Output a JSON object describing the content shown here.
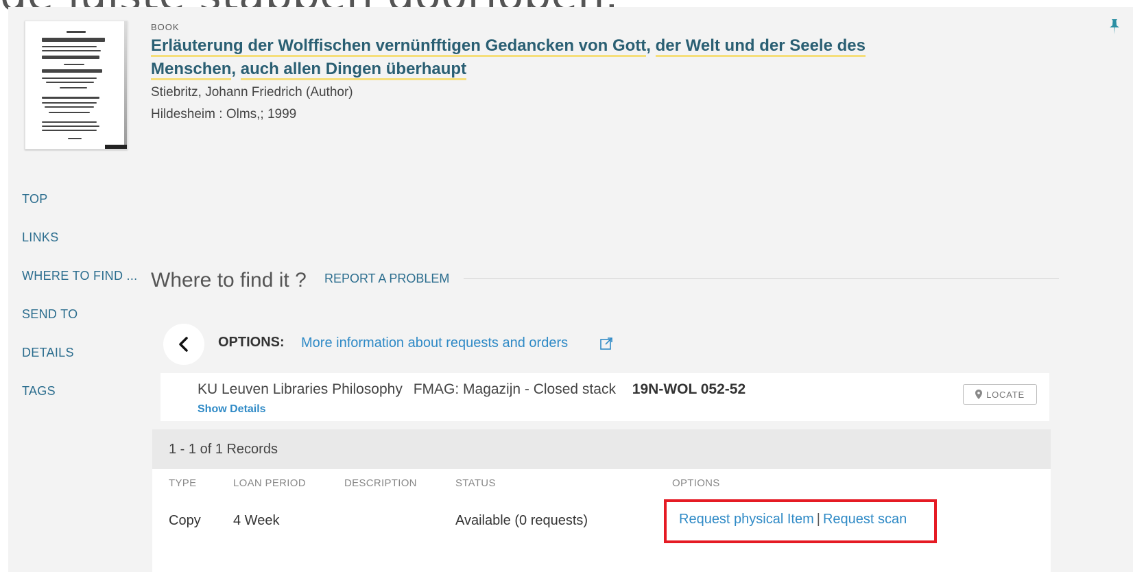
{
  "caption": "de juiste stappen doorlopen.",
  "record": {
    "type": "BOOK",
    "title_part1": "Erläuterung der Wolffischen vernünfftigen Gedancken von Gott",
    "title_sep1": ", ",
    "title_part2": "der Welt und der Seele des Menschen",
    "title_sep2": ", ",
    "title_part3": "auch allen Dingen überhaupt",
    "author": "Stiebritz, Johann Friedrich (Author)",
    "publisher": "Hildesheim : Olms,; 1999"
  },
  "nav": {
    "items": [
      "TOP",
      "LINKS",
      "WHERE TO FIND ...",
      "SEND TO",
      "DETAILS",
      "TAGS"
    ]
  },
  "where_to_find": {
    "title": "Where to find it ?",
    "report": "REPORT A PROBLEM"
  },
  "options": {
    "label": "OPTIONS:",
    "more_info": "More information about requests and orders"
  },
  "location": {
    "library": "KU Leuven Libraries Philosophy",
    "shelf": "FMAG: Magazijn - Closed stack",
    "call_number": "19N-WOL 052-52",
    "show_details": "Show Details",
    "locate": "LOCATE"
  },
  "records": {
    "count": "1 - 1 of 1 Records",
    "headers": [
      "TYPE",
      "LOAN PERIOD",
      "DESCRIPTION",
      "STATUS",
      "OPTIONS"
    ],
    "rows": [
      {
        "type": "Copy",
        "loan_period": "4 Week",
        "description": "",
        "status": "Available (0 requests)",
        "request_physical": "Request physical Item",
        "separator": "|",
        "request_scan": "Request scan"
      }
    ]
  },
  "colors": {
    "link": "#2f8ac6",
    "nav": "#2b6d8e",
    "title": "#2a5f73",
    "highlight_underline": "#f5de7a",
    "annotation_box": "#e51b24"
  }
}
